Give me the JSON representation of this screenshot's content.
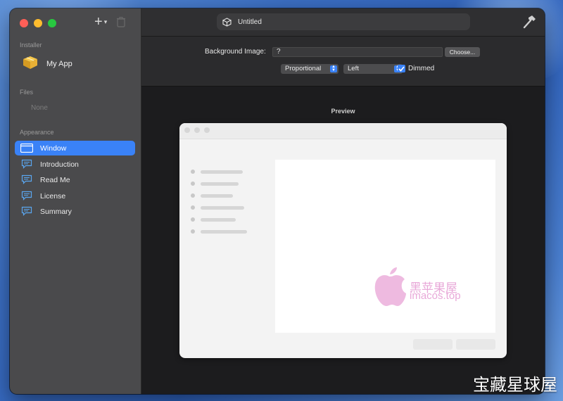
{
  "window": {
    "doc_title": "Untitled"
  },
  "sidebar": {
    "sections": {
      "installer": "Installer",
      "files": "Files",
      "appearance": "Appearance"
    },
    "installer_item": {
      "label": "My App",
      "icon": "package-box-icon"
    },
    "files_empty": "None",
    "appearance_items": [
      {
        "label": "Window",
        "icon": "window-icon",
        "selected": true
      },
      {
        "label": "Introduction",
        "icon": "speech-bubble-icon",
        "selected": false
      },
      {
        "label": "Read Me",
        "icon": "speech-bubble-icon",
        "selected": false
      },
      {
        "label": "License",
        "icon": "speech-bubble-icon",
        "selected": false
      },
      {
        "label": "Summary",
        "icon": "speech-bubble-icon",
        "selected": false
      }
    ]
  },
  "settings": {
    "background_image_label": "Background Image:",
    "background_image_value": "?",
    "choose_label": "Choose...",
    "scaling_value": "Proportional",
    "alignment_value": "Left",
    "dimmed_label": "Dimmed",
    "dimmed_checked": true
  },
  "preview": {
    "label": "Preview"
  },
  "watermark": {
    "cn": "黑苹果屋",
    "en": "imacos.top",
    "corner": "宝藏星球屋"
  },
  "colors": {
    "accent": "#3a82f7",
    "sidebar_bg": "#4a4a4c",
    "traffic_red": "#ff5f57",
    "traffic_yellow": "#febc2e",
    "traffic_green": "#28c840"
  }
}
